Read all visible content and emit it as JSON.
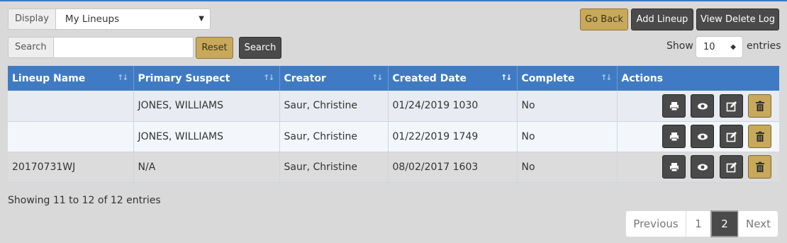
{
  "controls": {
    "display_label": "Display",
    "display_value": "My Lineups",
    "search_label": "Search",
    "search_value": "",
    "reset_label": "Reset",
    "search_button_label": "Search",
    "go_back_label": "Go Back",
    "add_lineup_label": "Add Lineup",
    "view_delete_log_label": "View Delete Log",
    "show_label": "Show",
    "entries_value": "10",
    "entries_label": "entries"
  },
  "table": {
    "headers": [
      "Lineup Name",
      "Primary Suspect",
      "Creator",
      "Created Date",
      "Complete",
      "Actions"
    ],
    "rows": [
      {
        "lineup_name": "",
        "primary_suspect": "JONES, WILLIAMS",
        "creator": "Saur, Christine",
        "created_date": "01/24/2019 1030",
        "complete": "No"
      },
      {
        "lineup_name": "",
        "primary_suspect": "JONES, WILLIAMS",
        "creator": "Saur, Christine",
        "created_date": "01/22/2019 1749",
        "complete": "No"
      },
      {
        "lineup_name": "20170731WJ",
        "primary_suspect": "N/A",
        "creator": "Saur, Christine",
        "created_date": "08/02/2017 1603",
        "complete": "No"
      }
    ],
    "action_icons": [
      "print-icon",
      "eye-icon",
      "edit-icon",
      "trash-icon"
    ]
  },
  "info_text": "Showing 11 to 12 of 12 entries",
  "pagination": {
    "previous": "Previous",
    "pages": [
      "1",
      "2"
    ],
    "active_page": "2",
    "next": "Next"
  },
  "colors": {
    "header_blue": "#3f7bc4",
    "gold": "#c8a95c",
    "dark": "#4a4a4a"
  }
}
